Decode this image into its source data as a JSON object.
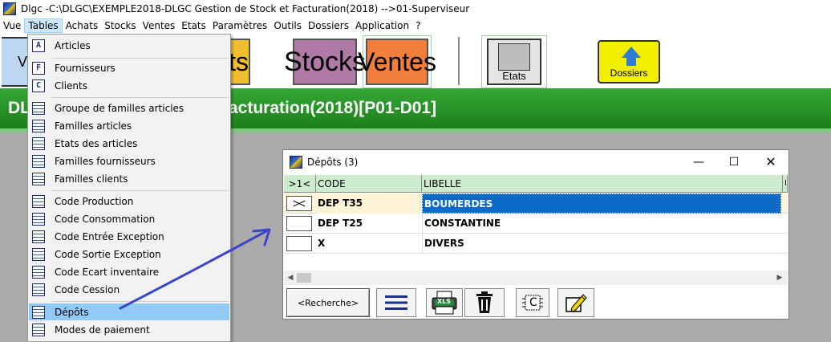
{
  "window": {
    "title": "Dlgc -C:\\DLGC\\EXEMPLE2018-DLGC Gestion de Stock et Facturation(2018) -->01-Superviseur"
  },
  "menubar": {
    "items": [
      {
        "label": "Vue"
      },
      {
        "label": "Tables"
      },
      {
        "label": "Achats"
      },
      {
        "label": "Stocks"
      },
      {
        "label": "Ventes"
      },
      {
        "label": "Etats"
      },
      {
        "label": "Paramètres"
      },
      {
        "label": "Outils"
      },
      {
        "label": "Dossiers"
      },
      {
        "label": "Application"
      },
      {
        "label": "?"
      }
    ],
    "active": "Tables"
  },
  "toolbar": {
    "partial_left": "V",
    "partial_tls": "ts",
    "stocks": "Stocks",
    "ventes": "Ventes",
    "etats": "Etats",
    "dossiers": "Dossiers"
  },
  "banner": {
    "left": "DL",
    "main": "acturation(2018)[P01-D01]"
  },
  "dropdown": {
    "items": [
      {
        "label": "Articles",
        "icon": "A"
      },
      {
        "label": "Fournisseurs",
        "icon": "F"
      },
      {
        "label": "Clients",
        "icon": "C"
      },
      {
        "label": "Groupe de familles articles",
        "icon": "grid"
      },
      {
        "label": "Familles articles",
        "icon": "grid"
      },
      {
        "label": "Etats des articles",
        "icon": "grid"
      },
      {
        "label": "Familles fournisseurs",
        "icon": "grid"
      },
      {
        "label": "Familles clients",
        "icon": "grid"
      },
      {
        "label": "Code Production",
        "icon": "grid"
      },
      {
        "label": "Code Consommation",
        "icon": "grid"
      },
      {
        "label": "Code Entrée Exception",
        "icon": "grid"
      },
      {
        "label": "Code Sortie Exception",
        "icon": "grid"
      },
      {
        "label": "Code Ecart inventaire",
        "icon": "grid"
      },
      {
        "label": "Code Cession",
        "icon": "grid"
      },
      {
        "label": "Dépôts",
        "icon": "grid"
      },
      {
        "label": "Modes de paiement",
        "icon": "grid"
      }
    ],
    "active": "Dépôts"
  },
  "depots": {
    "title": "Dépôts (3)",
    "controls": {
      "minimize": "—",
      "maximize": "☐",
      "close": "✕"
    },
    "columns": {
      "selector": ">1<",
      "code": "CODE",
      "libelle": "LIBELLE",
      "extra": "IN"
    },
    "rows": [
      {
        "code": "DEP T35",
        "libelle": "BOUMERDES"
      },
      {
        "code": "DEP T25",
        "libelle": "CONSTANTINE"
      },
      {
        "code": "X",
        "libelle": "DIVERS"
      }
    ],
    "scroll_left": "◀",
    "scroll_right": "▶",
    "buttons": {
      "recherche": "<Recherche>",
      "xls": "XLS",
      "c": "C"
    }
  }
}
